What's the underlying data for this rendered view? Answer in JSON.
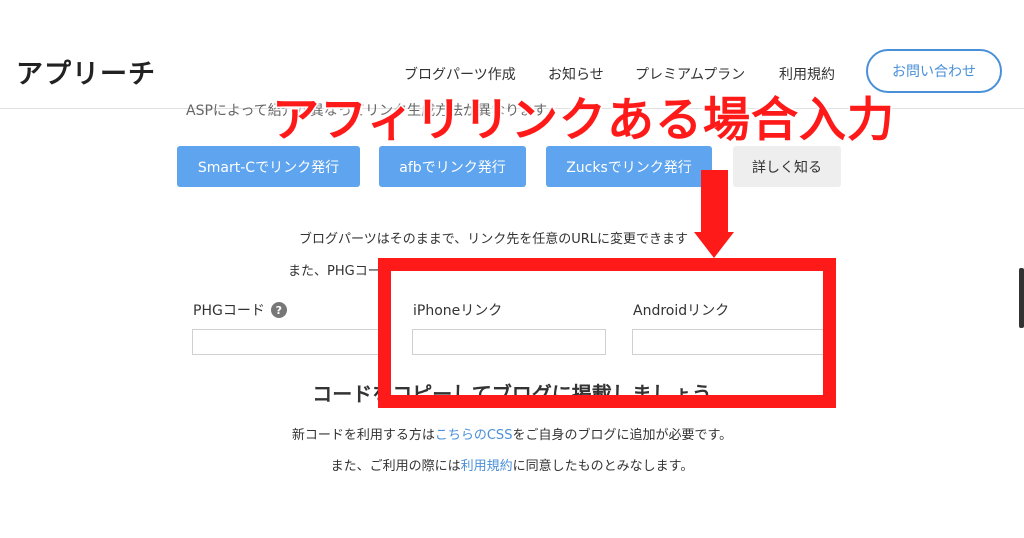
{
  "header": {
    "logo": "アプリーチ",
    "nav": [
      "ブログパーツ作成",
      "お知らせ",
      "プレミアムプラン",
      "利用規約"
    ],
    "contact_button": "お問い合わせ"
  },
  "intro_text_faded": "ASPによって紹介が異なってリンク生成方法が異なります",
  "buttons": {
    "smartc": "Smart-Cでリンク発行",
    "afb": "afbでリンク発行",
    "zucks": "Zucksでリンク発行",
    "details": "詳しく知る"
  },
  "info": {
    "line1": "ブログパーツはそのままで、リンク先を任意のURLに変更できます",
    "line2": "また、PHGコー"
  },
  "fields": {
    "phg_label": "PHGコード",
    "help": "?",
    "iphone_label": "iPhoneリンク",
    "android_label": "Androidリンク"
  },
  "section_title": "コードをコピーしてブログに掲載しましょう",
  "footer": {
    "line1_pre": "新コードを利用する方は",
    "line1_link": "こちらのCSS",
    "line1_post": "をご自身のブログに追加が必要です。",
    "line2_pre": "また、ご利用の際には",
    "line2_link": "利用規約",
    "line2_post": "に同意したものとみなします。"
  },
  "annotation": {
    "banner": "アフィリリンクある場合入力",
    "color": "#ff1a1a"
  },
  "colors": {
    "accent_blue": "#5ea4ee",
    "link_blue": "#4a90d9"
  }
}
